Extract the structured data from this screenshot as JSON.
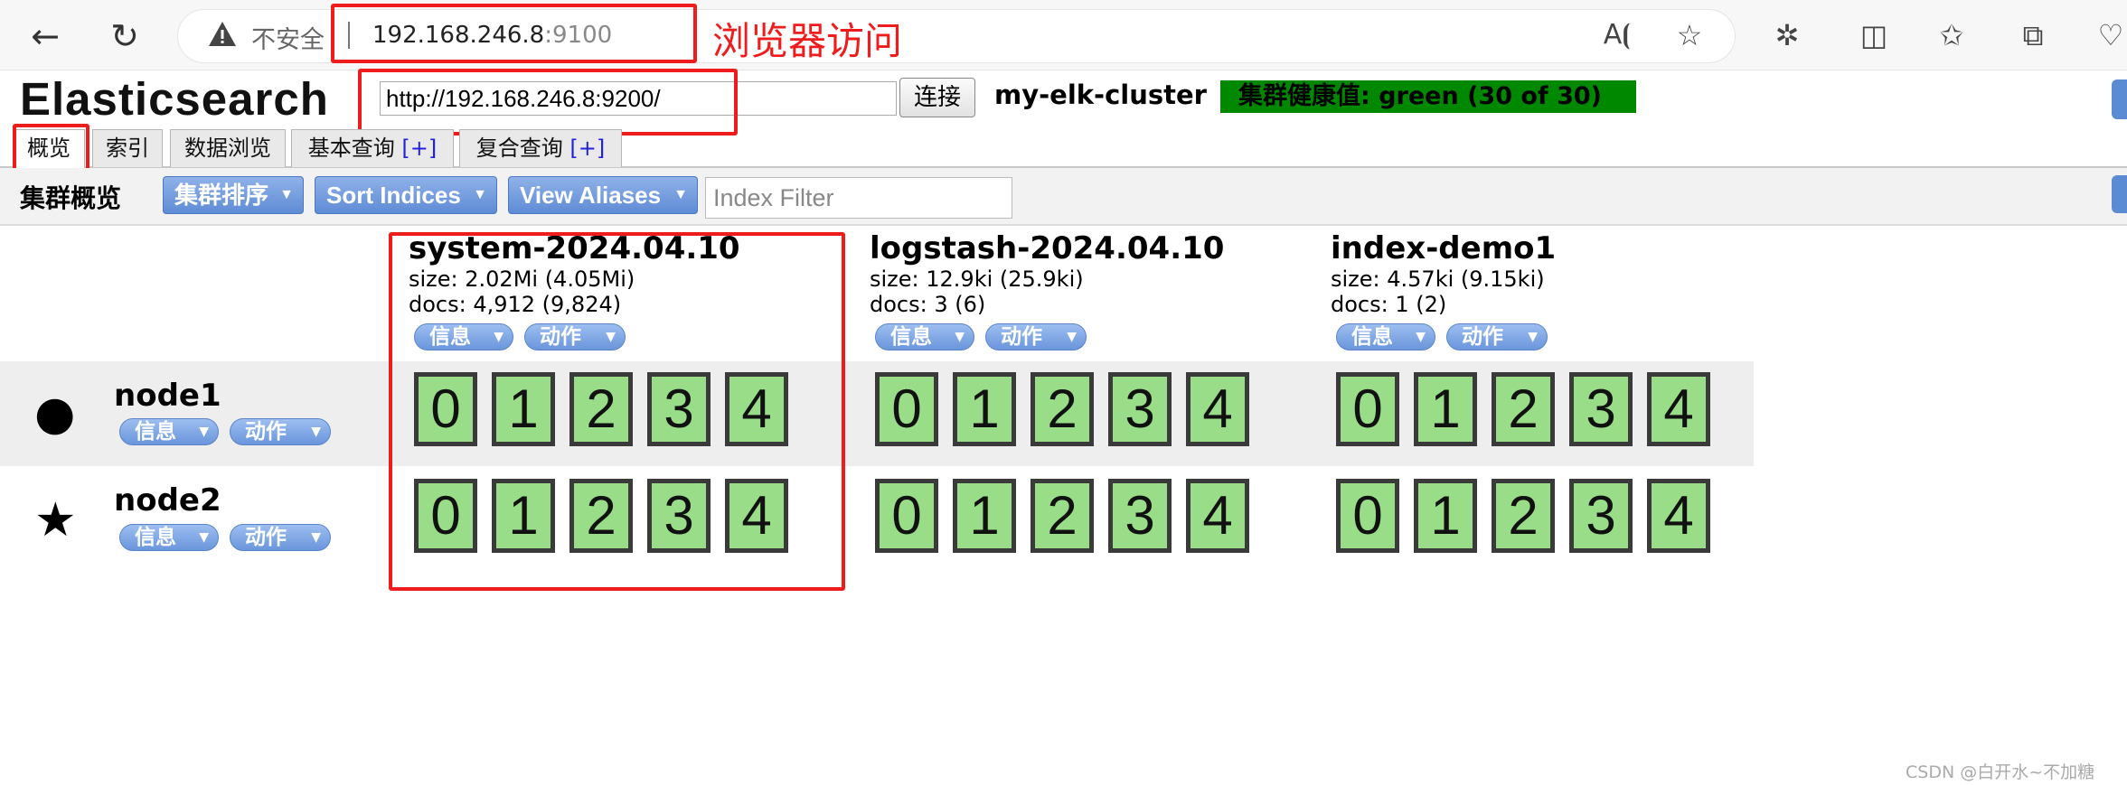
{
  "browser": {
    "insecure_label": "不安全",
    "url_host": "192.168.246.8",
    "url_port": ":9100",
    "icons": [
      "back-icon",
      "reload-icon",
      "warning-icon",
      "read-aloud-icon",
      "favorite-star-icon",
      "extensions-icon",
      "split-screen-icon",
      "favorites-icon",
      "collections-icon",
      "browser-health-icon"
    ]
  },
  "annotation": {
    "text": "浏览器访问",
    "color": "#ee1c1c"
  },
  "es": {
    "title": "Elasticsearch",
    "connect_url": "http://192.168.246.8:9200/",
    "connect_button": "连接",
    "cluster_name": "my-elk-cluster",
    "health": "集群健康值: green (30 of 30)",
    "health_color": "#008800"
  },
  "tabs": [
    {
      "label": "概览",
      "plus": ""
    },
    {
      "label": "索引",
      "plus": ""
    },
    {
      "label": "数据浏览",
      "plus": ""
    },
    {
      "label": "基本查询",
      "plus": "[+]"
    },
    {
      "label": "复合查询",
      "plus": "[+]"
    }
  ],
  "toolbar": {
    "title": "集群概览",
    "sort_cluster": "集群排序",
    "sort_indices": "Sort Indices",
    "view_aliases": "View Aliases",
    "filter_placeholder": "Index Filter"
  },
  "pills": {
    "info": "信息",
    "action": "动作"
  },
  "indices": [
    {
      "name": "system-2024.04.10",
      "size": "size: 2.02Mi (4.05Mi)",
      "docs": "docs: 4,912 (9,824)"
    },
    {
      "name": "logstash-2024.04.10",
      "size": "size: 12.9ki (25.9ki)",
      "docs": "docs: 3 (6)"
    },
    {
      "name": "index-demo1",
      "size": "size: 4.57ki (9.15ki)",
      "docs": "docs: 1 (2)"
    }
  ],
  "nodes": [
    {
      "name": "node1",
      "icon": "circle-icon",
      "symbol": "●"
    },
    {
      "name": "node2",
      "icon": "star-icon",
      "symbol": "★"
    }
  ],
  "shards": [
    "0",
    "1",
    "2",
    "3",
    "4"
  ],
  "shard_color": "#99dd88",
  "watermark": "CSDN @白开水~不加糖"
}
